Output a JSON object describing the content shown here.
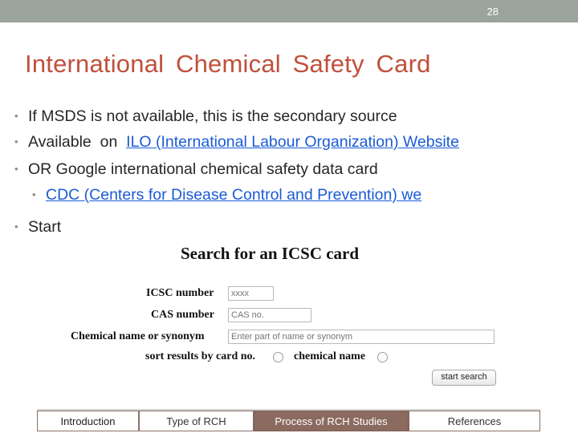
{
  "slide": {
    "page_number": "28",
    "title": "International  Chemical  Safety  Card",
    "bullets": [
      {
        "text": "If MSDS is not available, this is the secondary source"
      },
      {
        "prefix": "Available  on  ",
        "link": "ILO  (International  Labour  Organization) Website"
      },
      {
        "text": "OR  Google international chemical safety data card"
      },
      {
        "link": "CDC  (Centers  for  Disease  Control  and  Prevention) we"
      },
      {
        "text": "Start"
      }
    ],
    "bullet_glyph": "•"
  },
  "icsc_form": {
    "title": "Search for an ICSC card",
    "icsc_number_label": "ICSC number",
    "icsc_number_placeholder": "xxxx",
    "cas_number_label": "CAS number",
    "cas_number_placeholder": "CAS no.",
    "chemical_name_label": "Chemical name or synonym",
    "chemical_name_placeholder": "Enter part of name or synonym",
    "sort_label": "sort results by card no.",
    "sort_option_2": "chemical name",
    "start_search_label": "start search"
  },
  "nav": {
    "tabs": [
      "Introduction",
      "Type of RCH",
      "Process of RCH Studies",
      "References"
    ],
    "active_index": 2
  },
  "colors": {
    "topbar": "#9aa39c",
    "title": "#c0503c",
    "link": "#1a5bd6",
    "active_tab": "#8b6a60"
  }
}
